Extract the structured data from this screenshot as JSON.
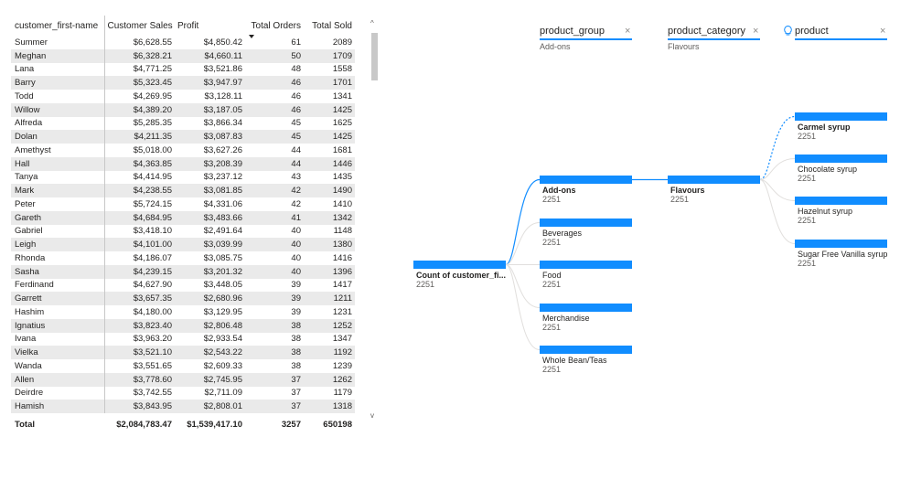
{
  "table": {
    "columns": [
      "customer_first-name",
      "Customer Sales",
      "Profit",
      "Total Orders",
      "Total Sold"
    ],
    "sorted_column_index": 3,
    "rows": [
      [
        "Summer",
        "$6,628.55",
        "$4,850.42",
        "61",
        "2089"
      ],
      [
        "Meghan",
        "$6,328.21",
        "$4,660.11",
        "50",
        "1709"
      ],
      [
        "Lana",
        "$4,771.25",
        "$3,521.86",
        "48",
        "1558"
      ],
      [
        "Barry",
        "$5,323.45",
        "$3,947.97",
        "46",
        "1701"
      ],
      [
        "Todd",
        "$4,269.95",
        "$3,128.11",
        "46",
        "1341"
      ],
      [
        "Willow",
        "$4,389.20",
        "$3,187.05",
        "46",
        "1425"
      ],
      [
        "Alfreda",
        "$5,285.35",
        "$3,866.34",
        "45",
        "1625"
      ],
      [
        "Dolan",
        "$4,211.35",
        "$3,087.83",
        "45",
        "1425"
      ],
      [
        "Amethyst",
        "$5,018.00",
        "$3,627.26",
        "44",
        "1681"
      ],
      [
        "Hall",
        "$4,363.85",
        "$3,208.39",
        "44",
        "1446"
      ],
      [
        "Tanya",
        "$4,414.95",
        "$3,237.12",
        "43",
        "1435"
      ],
      [
        "Mark",
        "$4,238.55",
        "$3,081.85",
        "42",
        "1490"
      ],
      [
        "Peter",
        "$5,724.15",
        "$4,331.06",
        "42",
        "1410"
      ],
      [
        "Gareth",
        "$4,684.95",
        "$3,483.66",
        "41",
        "1342"
      ],
      [
        "Gabriel",
        "$3,418.10",
        "$2,491.64",
        "40",
        "1148"
      ],
      [
        "Leigh",
        "$4,101.00",
        "$3,039.99",
        "40",
        "1380"
      ],
      [
        "Rhonda",
        "$4,186.07",
        "$3,085.75",
        "40",
        "1416"
      ],
      [
        "Sasha",
        "$4,239.15",
        "$3,201.32",
        "40",
        "1396"
      ],
      [
        "Ferdinand",
        "$4,627.90",
        "$3,448.05",
        "39",
        "1417"
      ],
      [
        "Garrett",
        "$3,657.35",
        "$2,680.96",
        "39",
        "1211"
      ],
      [
        "Hashim",
        "$4,180.00",
        "$3,129.95",
        "39",
        "1231"
      ],
      [
        "Ignatius",
        "$3,823.40",
        "$2,806.48",
        "38",
        "1252"
      ],
      [
        "Ivana",
        "$3,963.20",
        "$2,933.54",
        "38",
        "1347"
      ],
      [
        "Vielka",
        "$3,521.10",
        "$2,543.22",
        "38",
        "1192"
      ],
      [
        "Wanda",
        "$3,551.65",
        "$2,609.33",
        "38",
        "1239"
      ],
      [
        "Allen",
        "$3,778.60",
        "$2,745.95",
        "37",
        "1262"
      ],
      [
        "Deirdre",
        "$3,742.55",
        "$2,711.09",
        "37",
        "1179"
      ],
      [
        "Hamish",
        "$3,843.95",
        "$2,808.01",
        "37",
        "1318"
      ]
    ],
    "total": [
      "Total",
      "$2,084,783.47",
      "$1,539,417.10",
      "3257",
      "650198"
    ],
    "scroll_up_glyph": "^",
    "scroll_down_glyph": "v"
  },
  "decomposition_tree": {
    "accent_color": "#118dff",
    "close_glyph": "×",
    "bulb_glyph": "💡",
    "levels": [
      {
        "header": "",
        "selected": "",
        "nodes": [
          {
            "label": "Count of customer_fi...",
            "value": "2251",
            "bold": true,
            "fill": 1.0
          }
        ]
      },
      {
        "header": "product_group",
        "selected": "Add-ons",
        "nodes": [
          {
            "label": "Add-ons",
            "value": "2251",
            "bold": true,
            "fill": 1.0
          },
          {
            "label": "Beverages",
            "value": "2251",
            "bold": false,
            "fill": 1.0
          },
          {
            "label": "Food",
            "value": "2251",
            "bold": false,
            "fill": 1.0
          },
          {
            "label": "Merchandise",
            "value": "2251",
            "bold": false,
            "fill": 1.0
          },
          {
            "label": "Whole Bean/Teas",
            "value": "2251",
            "bold": false,
            "fill": 1.0
          }
        ]
      },
      {
        "header": "product_category",
        "selected": "Flavours",
        "nodes": [
          {
            "label": "Flavours",
            "value": "2251",
            "bold": true,
            "fill": 1.0
          }
        ]
      },
      {
        "header": "product",
        "selected": "",
        "ai_split": true,
        "nodes": [
          {
            "label": "Carmel syrup",
            "value": "2251",
            "bold": true,
            "fill": 1.0
          },
          {
            "label": "Chocolate syrup",
            "value": "2251",
            "bold": false,
            "fill": 1.0
          },
          {
            "label": "Hazelnut syrup",
            "value": "2251",
            "bold": false,
            "fill": 1.0
          },
          {
            "label": "Sugar Free Vanilla syrup",
            "value": "2251",
            "bold": false,
            "fill": 1.0
          }
        ]
      }
    ]
  }
}
